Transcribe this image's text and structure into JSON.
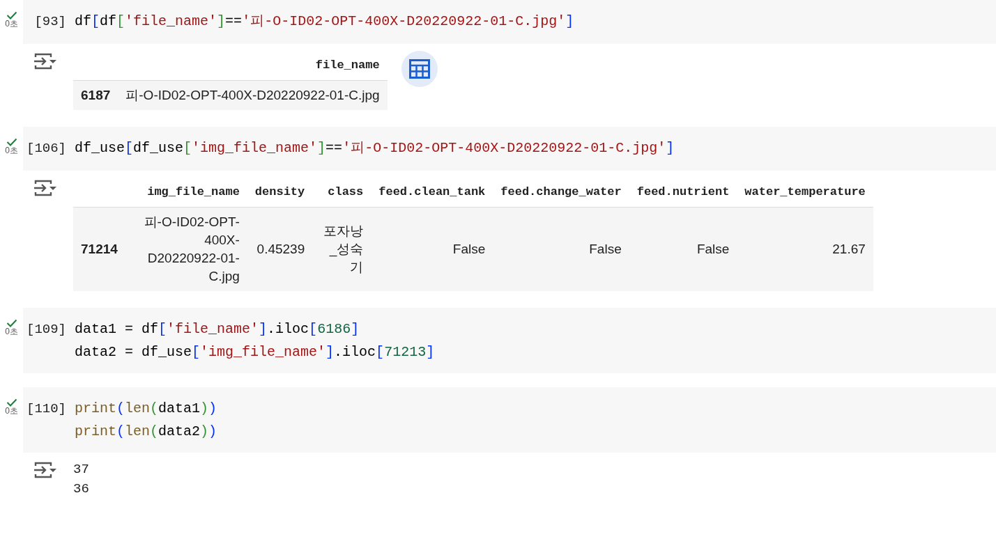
{
  "cells": [
    {
      "exec_count": "[93]",
      "time": "0초",
      "succeeded": true,
      "code": [
        [
          {
            "t": "df",
            "kind": "plain"
          },
          {
            "t": "[",
            "kind": "bracket1"
          },
          {
            "t": "df",
            "kind": "plain"
          },
          {
            "t": "[",
            "kind": "bracket2"
          },
          {
            "t": "'file_name'",
            "kind": "string"
          },
          {
            "t": "]",
            "kind": "bracket2"
          },
          {
            "t": "==",
            "kind": "plain"
          },
          {
            "t": "'피-O-ID02-OPT-400X-D20220922-01-C.jpg'",
            "kind": "string"
          },
          {
            "t": "]",
            "kind": "bracket1"
          }
        ]
      ],
      "output": {
        "kind": "table",
        "columns": [
          "file_name"
        ],
        "rows": [
          {
            "index": "6187",
            "cells": [
              "피-O-ID02-OPT-400X-D20220922-01-C.jpg"
            ]
          }
        ]
      }
    },
    {
      "exec_count": "[106]",
      "time": "0초",
      "succeeded": true,
      "code": [
        [
          {
            "t": "df_use",
            "kind": "plain"
          },
          {
            "t": "[",
            "kind": "bracket1"
          },
          {
            "t": "df_use",
            "kind": "plain"
          },
          {
            "t": "[",
            "kind": "bracket2"
          },
          {
            "t": "'img_file_name'",
            "kind": "string"
          },
          {
            "t": "]",
            "kind": "bracket2"
          },
          {
            "t": "==",
            "kind": "plain"
          },
          {
            "t": "'피-O-ID02-OPT-400X-D20220922-01-C.jpg'",
            "kind": "string"
          },
          {
            "t": "]",
            "kind": "bracket1"
          }
        ]
      ],
      "output": {
        "kind": "table",
        "columns": [
          "img_file_name",
          "density",
          "class",
          "feed.clean_tank",
          "feed.change_water",
          "feed.nutrient",
          "water_temperature"
        ],
        "rows": [
          {
            "index": "71214",
            "cells": [
              "피-O-ID02-OPT-400X-D20220922-01-C.jpg",
              "0.45239",
              "포자낭_성숙기",
              "False",
              "False",
              "False",
              "21.67"
            ]
          }
        ]
      }
    },
    {
      "exec_count": "[109]",
      "time": "0초",
      "succeeded": true,
      "code": [
        [
          {
            "t": "data1 = df",
            "kind": "plain"
          },
          {
            "t": "[",
            "kind": "bracket1"
          },
          {
            "t": "'file_name'",
            "kind": "string"
          },
          {
            "t": "]",
            "kind": "bracket1"
          },
          {
            "t": ".iloc",
            "kind": "plain"
          },
          {
            "t": "[",
            "kind": "bracket1"
          },
          {
            "t": "6186",
            "kind": "number"
          },
          {
            "t": "]",
            "kind": "bracket1"
          }
        ],
        [
          {
            "t": "data2 = df_use",
            "kind": "plain"
          },
          {
            "t": "[",
            "kind": "bracket1"
          },
          {
            "t": "'img_file_name'",
            "kind": "string"
          },
          {
            "t": "]",
            "kind": "bracket1"
          },
          {
            "t": ".iloc",
            "kind": "plain"
          },
          {
            "t": "[",
            "kind": "bracket1"
          },
          {
            "t": "71213",
            "kind": "number"
          },
          {
            "t": "]",
            "kind": "bracket1"
          }
        ]
      ]
    },
    {
      "exec_count": "[110]",
      "time": "0초",
      "succeeded": true,
      "code": [
        [
          {
            "t": "print",
            "kind": "func"
          },
          {
            "t": "(",
            "kind": "bracket1"
          },
          {
            "t": "len",
            "kind": "func"
          },
          {
            "t": "(",
            "kind": "bracket2"
          },
          {
            "t": "data1",
            "kind": "plain"
          },
          {
            "t": ")",
            "kind": "bracket2"
          },
          {
            "t": ")",
            "kind": "bracket1"
          }
        ],
        [
          {
            "t": "print",
            "kind": "func"
          },
          {
            "t": "(",
            "kind": "bracket1"
          },
          {
            "t": "len",
            "kind": "func"
          },
          {
            "t": "(",
            "kind": "bracket2"
          },
          {
            "t": "data2",
            "kind": "plain"
          },
          {
            "t": ")",
            "kind": "bracket2"
          },
          {
            "t": ")",
            "kind": "bracket1"
          }
        ]
      ],
      "output": {
        "kind": "text",
        "lines": [
          "37",
          "36"
        ]
      }
    }
  ]
}
